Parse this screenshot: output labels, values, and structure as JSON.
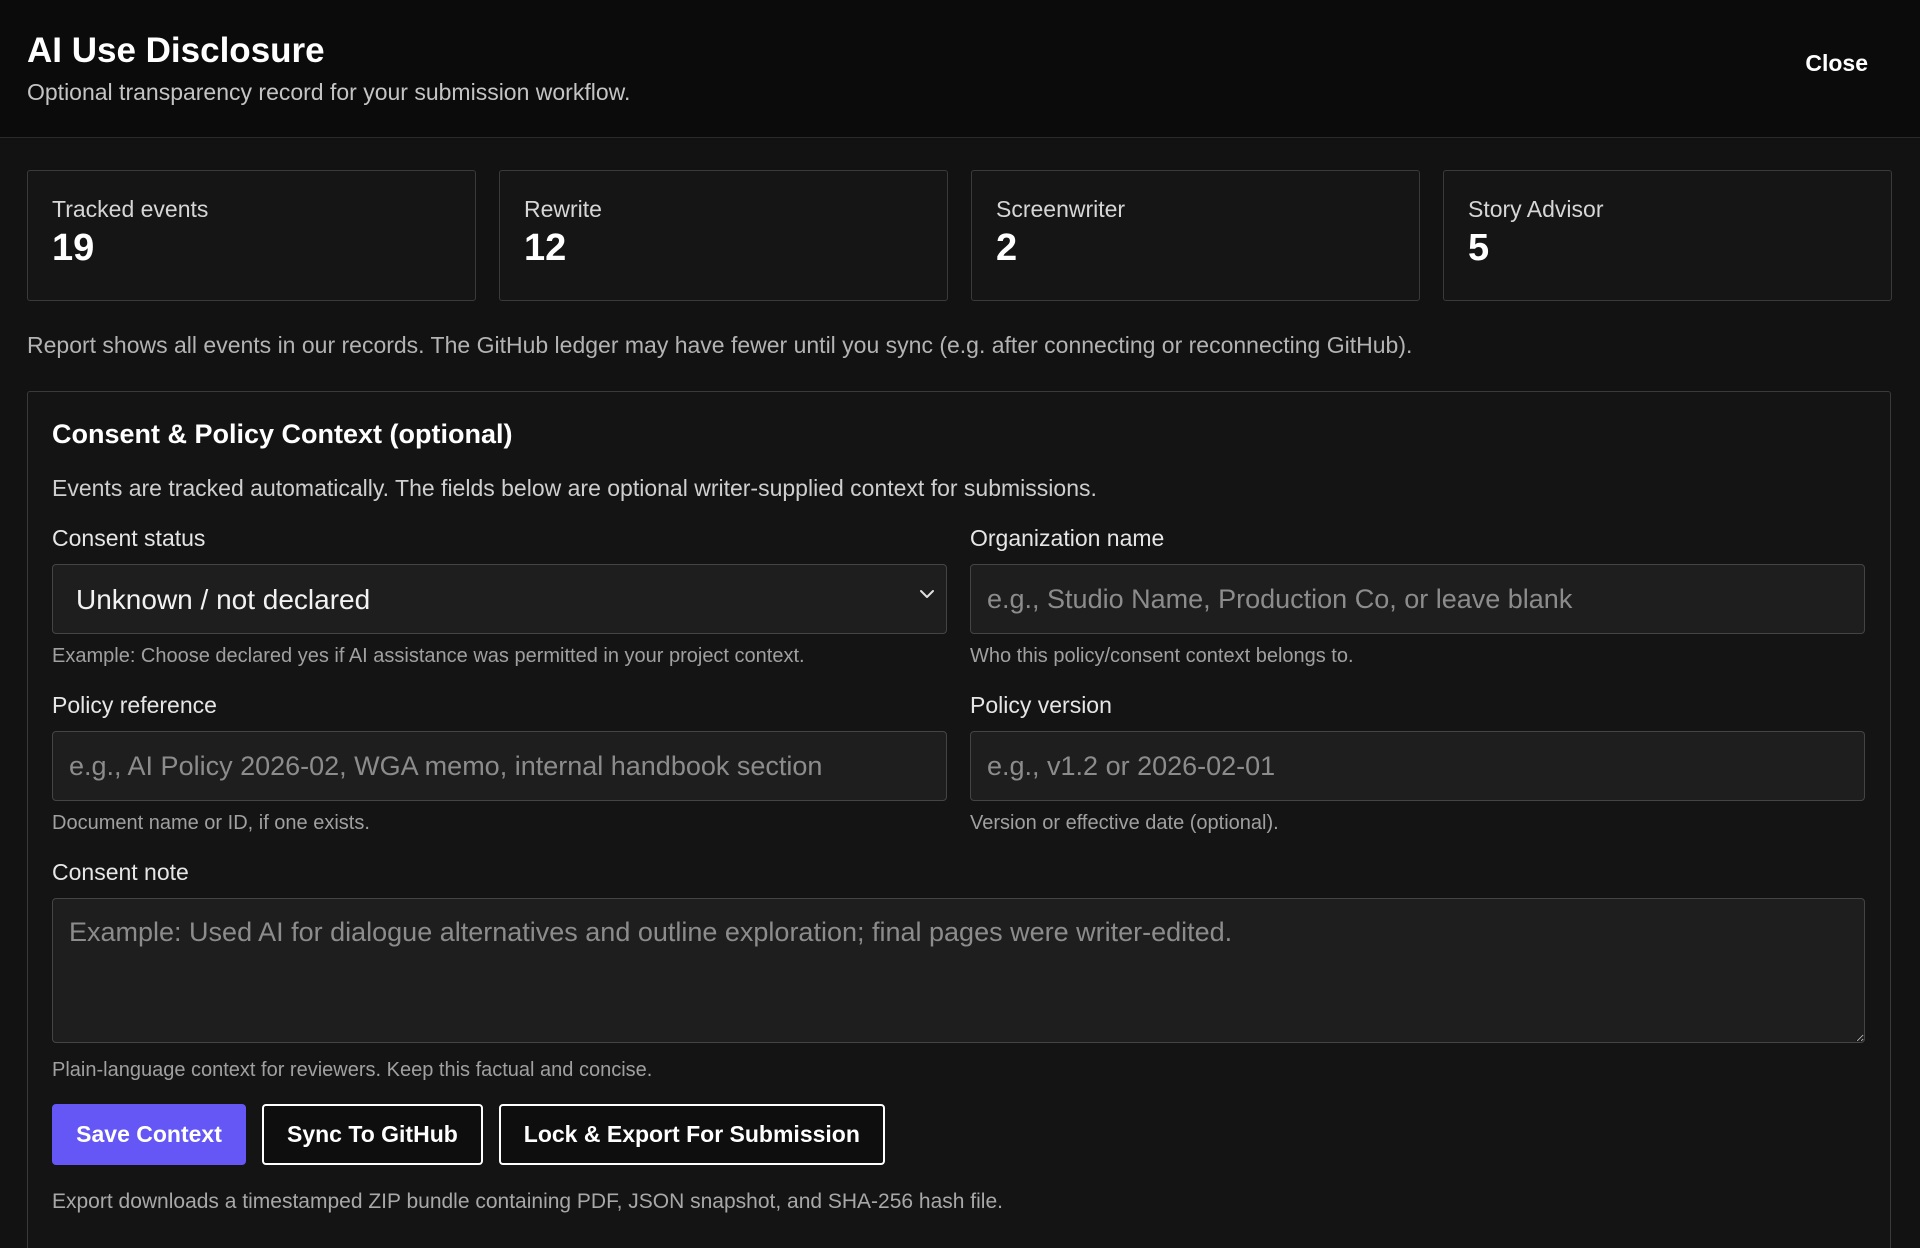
{
  "header": {
    "title": "AI Use Disclosure",
    "subtitle": "Optional transparency record for your submission workflow.",
    "close_label": "Close"
  },
  "stats": [
    {
      "label": "Tracked events",
      "value": "19"
    },
    {
      "label": "Rewrite",
      "value": "12"
    },
    {
      "label": "Screenwriter",
      "value": "2"
    },
    {
      "label": "Story Advisor",
      "value": "5"
    }
  ],
  "report_note": "Report shows all events in our records. The GitHub ledger may have fewer until you sync (e.g. after connecting or reconnecting GitHub).",
  "panel": {
    "title": "Consent & Policy Context (optional)",
    "description": "Events are tracked automatically. The fields below are optional writer-supplied context for submissions.",
    "consent_status": {
      "label": "Consent status",
      "selected": "Unknown / not declared",
      "help": "Example: Choose declared yes if AI assistance was permitted in your project context."
    },
    "organization": {
      "label": "Organization name",
      "placeholder": "e.g., Studio Name, Production Co, or leave blank",
      "help": "Who this policy/consent context belongs to."
    },
    "policy_reference": {
      "label": "Policy reference",
      "placeholder": "e.g., AI Policy 2026-02, WGA memo, internal handbook section",
      "help": "Document name or ID, if one exists."
    },
    "policy_version": {
      "label": "Policy version",
      "placeholder": "e.g., v1.2 or 2026-02-01",
      "help": "Version or effective date (optional)."
    },
    "consent_note": {
      "label": "Consent note",
      "placeholder": "Example: Used AI for dialogue alternatives and outline exploration; final pages were writer-edited.",
      "help": "Plain-language context for reviewers. Keep this factual and concise."
    },
    "actions": {
      "save_label": "Save Context",
      "sync_label": "Sync To GitHub",
      "lock_label": "Lock & Export For Submission"
    },
    "export_note": "Export downloads a timestamped ZIP bundle containing PDF, JSON snapshot, and SHA-256 hash file."
  },
  "colors": {
    "accent": "#6457f5",
    "background": "#121212",
    "header_bg": "#0b0b0b"
  },
  "icons": {
    "select_chevron": "chevron-down-icon"
  }
}
